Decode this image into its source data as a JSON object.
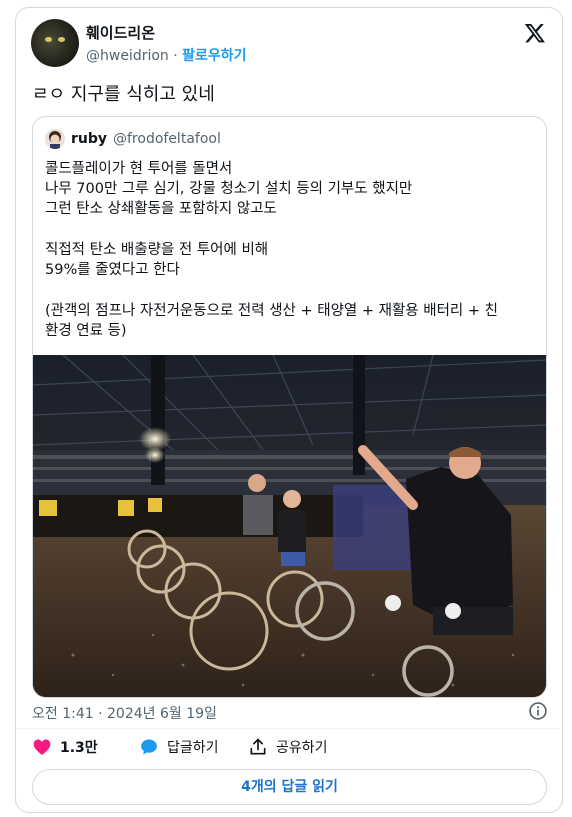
{
  "author": {
    "display_name": "훼이드리온",
    "handle": "@hweidrion",
    "follow_label": "팔로우하기"
  },
  "tweet": {
    "text": "ㄹㅇ 지구를 식히고 있네"
  },
  "quote": {
    "display_name": "ruby",
    "handle": "@frodofeltafool",
    "lines": [
      "콜드플레이가 현 투어를 돌면서",
      "나무 700만 그루 심기, 강물 청소기 설치 등의 기부도 했지만",
      "그런 탄소 상쇄활동을 포함하지 않고도",
      "직접적 탄소 배출량을 전 투어에 비해",
      "59%를 줄였다고 한다",
      "(관객의 점프나 자전거운동으로 전력 생산 + 태양열 + 재활용 배터리 + 친",
      "환경 연료 등)"
    ]
  },
  "meta": {
    "time": "오전 1:41",
    "separator": "·",
    "date": "2024년 6월 19일"
  },
  "actions": {
    "like_count": "1.3만",
    "reply_label": "답글하기",
    "share_label": "공유하기"
  },
  "read_replies": "4개의 답글 읽기",
  "colors": {
    "accent": "#1d9bf0",
    "like": "#f91880",
    "text": "#0f1419",
    "muted": "#536471",
    "border": "#cfd9de"
  },
  "icons": [
    "x-logo-icon",
    "info-icon",
    "heart-icon",
    "reply-bubble-icon",
    "share-icon"
  ]
}
